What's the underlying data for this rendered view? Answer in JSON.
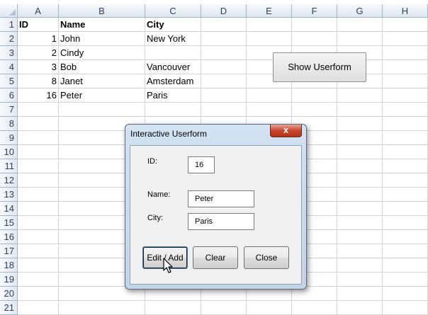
{
  "columns": [
    "A",
    "B",
    "C",
    "D",
    "E",
    "F",
    "G",
    "H"
  ],
  "rows": [
    "1",
    "2",
    "3",
    "4",
    "5",
    "6",
    "7",
    "8",
    "9",
    "10",
    "11",
    "12",
    "13",
    "14",
    "15",
    "16",
    "17",
    "18",
    "19",
    "20",
    "21"
  ],
  "table": {
    "headers": {
      "id": "ID",
      "name": "Name",
      "city": "City"
    },
    "data": [
      {
        "id": "1",
        "name": "John",
        "city": "New York"
      },
      {
        "id": "2",
        "name": "Cindy",
        "city": ""
      },
      {
        "id": "3",
        "name": "Bob",
        "city": "Vancouver"
      },
      {
        "id": "8",
        "name": "Janet",
        "city": "Amsterdam"
      },
      {
        "id": "16",
        "name": "Peter",
        "city": "Paris"
      }
    ]
  },
  "sheet_button": {
    "label": "Show Userform"
  },
  "dialog": {
    "title": "Interactive Userform",
    "close_glyph": "x",
    "id_label": "ID:",
    "id_value": "16",
    "name_label": "Name:",
    "name_value": "Peter",
    "city_label": "City:",
    "city_value": "Paris",
    "buttons": {
      "edit_add": "Edit / Add",
      "clear": "Clear",
      "close": "Close"
    }
  },
  "icons": {
    "cursor": "arrow-pointer-icon",
    "close": "close-icon"
  }
}
